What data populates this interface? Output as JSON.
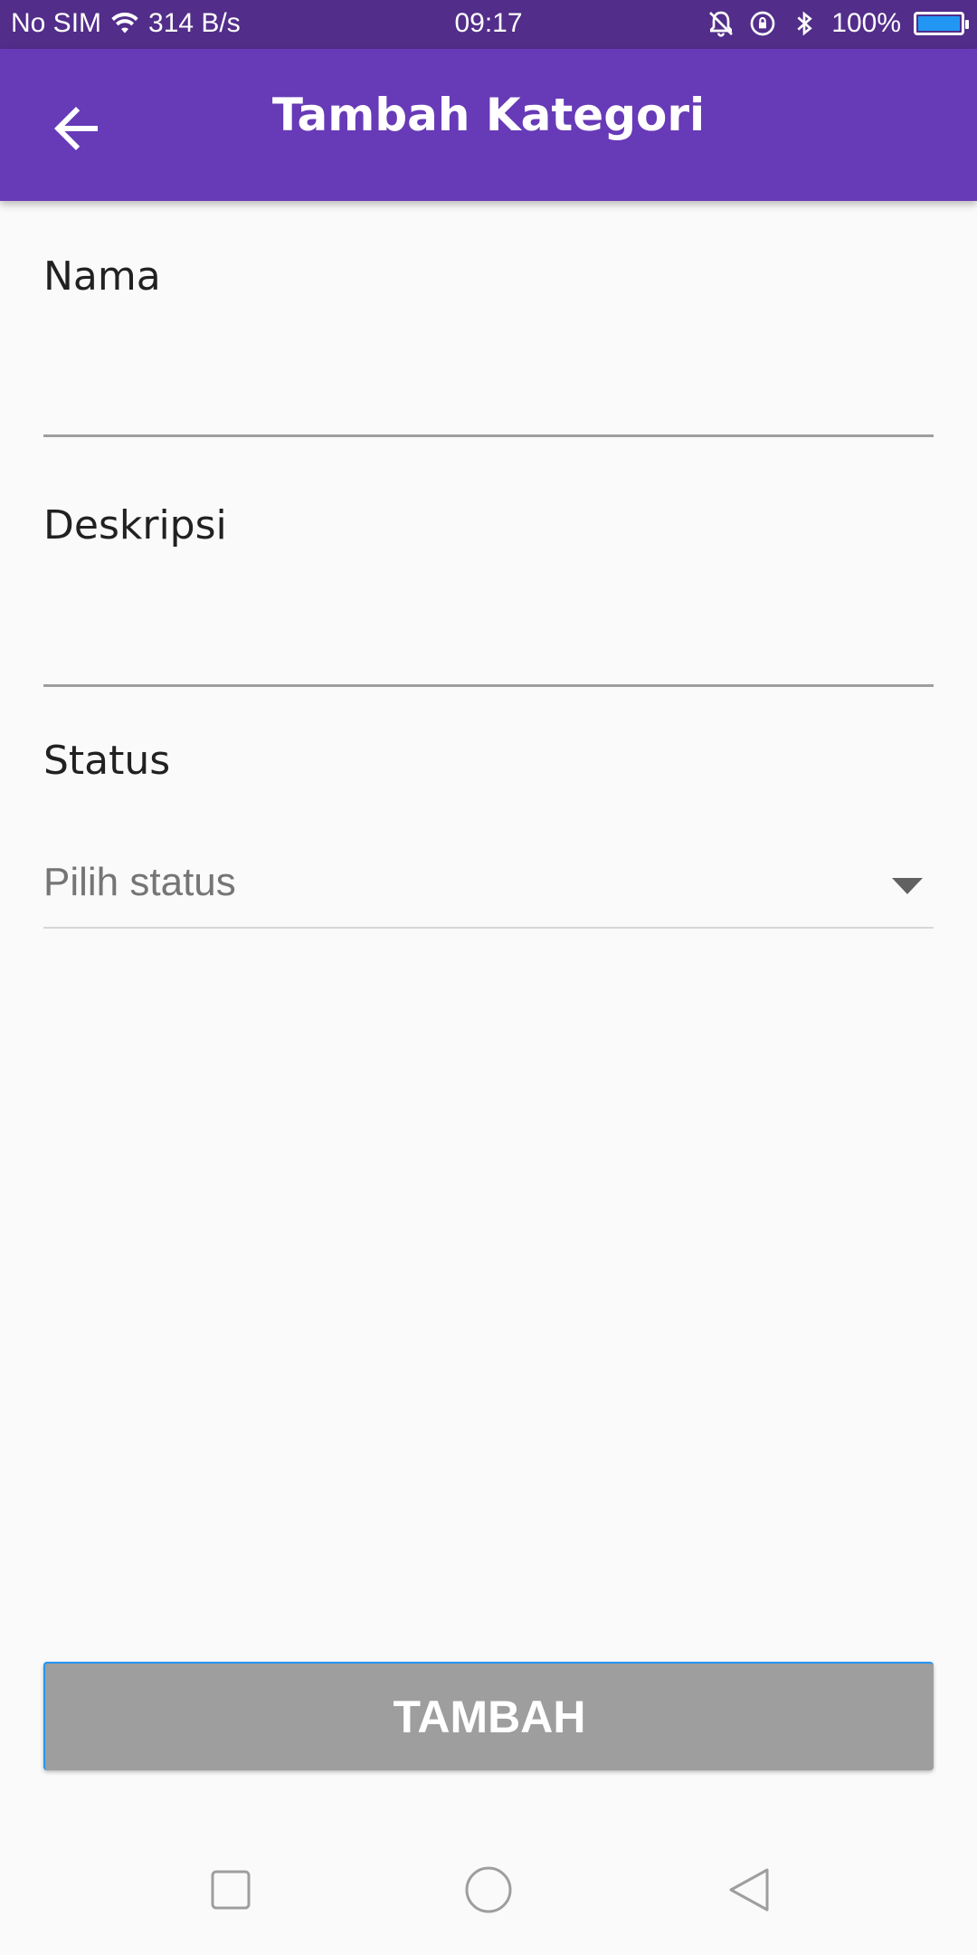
{
  "status_bar": {
    "carrier": "No SIM",
    "speed": "314 B/s",
    "time": "09:17",
    "battery": "100%",
    "battery_color": "#2196f3"
  },
  "app_bar": {
    "title": "Tambah Kategori",
    "color": "#673ab7",
    "back_icon": "arrow-back-icon"
  },
  "form": {
    "nama": {
      "label": "Nama",
      "value": ""
    },
    "deskripsi": {
      "label": "Deskripsi",
      "value": ""
    },
    "status": {
      "label": "Status",
      "placeholder": "Pilih status"
    }
  },
  "submit_button": {
    "label": "TAMBAH",
    "color": "#9e9e9e"
  },
  "nav_bar": {
    "icons": [
      "recents-square-icon",
      "home-circle-icon",
      "back-triangle-icon"
    ]
  }
}
